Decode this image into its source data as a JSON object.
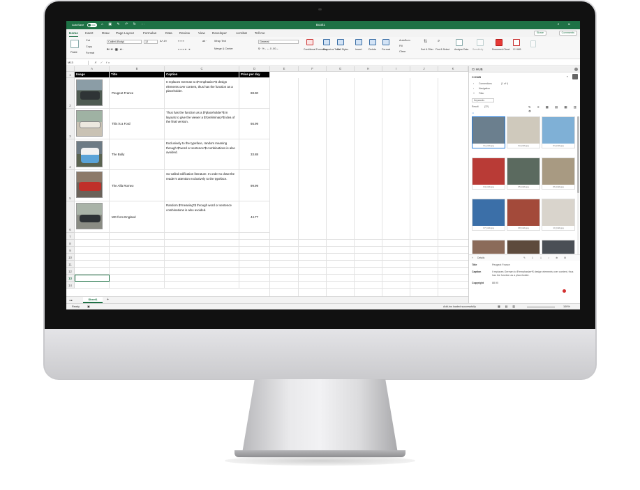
{
  "window": {
    "autosave_label": "AutoSave",
    "autosave_state": "OFF",
    "doc_title": "Book1"
  },
  "menu": {
    "tabs": [
      "Home",
      "Insert",
      "Draw",
      "Page Layout",
      "Formulas",
      "Data",
      "Review",
      "View",
      "Developer",
      "Acrobat",
      "Tell me"
    ],
    "share": "Share",
    "comments": "Comments"
  },
  "ribbon": {
    "paste": "Paste",
    "cut": "Cut",
    "copy": "Copy",
    "format": "Format",
    "font_name": "Calibri (Body)",
    "font_size": "12",
    "wrap_text": "Wrap Text",
    "merge_center": "Merge & Center",
    "number_format": "General",
    "conditional_formatting": "Conditional Formatting",
    "format_as_table": "Format as Table",
    "cell_styles": "Cell Styles",
    "insert": "Insert",
    "delete": "Delete",
    "format2": "Format",
    "autosum": "AutoSum",
    "fill": "Fill",
    "clear": "Clear",
    "sort_filter": "Sort & Filter",
    "find_select": "Find & Select",
    "analyze_data": "Analyze Data",
    "sensitivity": "Sensitivity",
    "document_cloud": "Document Cloud",
    "ci_hub": "CI HUB"
  },
  "formula_bar": {
    "name_box": "M13",
    "fx": "fx"
  },
  "sheet": {
    "columns": [
      "A",
      "B",
      "C",
      "D",
      "E",
      "F",
      "G",
      "H",
      "I",
      "J",
      "K"
    ],
    "header_row": {
      "image": "Image",
      "title": "Title",
      "caption": "Caption",
      "price": "Price per day"
    },
    "rows": [
      {
        "title": "Peugeot France",
        "caption": "It replaces German to $*emphasize*$ design elements over content, thus has the function as a placeholder.",
        "price": "88.90"
      },
      {
        "title": "This is a Ford",
        "caption": "Thus has the function as a $*placeholder*$ in layouts to give the viewer a $*preliminary*$ idea of the final version.",
        "price": "66.99"
      },
      {
        "title": "The Bully",
        "caption": "Exclusively to the typeface, random meaning through $*word or sentence*$ combinations is also avoided.",
        "price": "33.88"
      },
      {
        "title": "The Alfa Romeo",
        "caption": "So-called edification literature. In order to draw the reader's attention exclusively to the typeface.",
        "price": "99.99"
      },
      {
        "title": "MG from England",
        "caption": "Random $*meaning*$ through word or sentence combinations is also avoided.",
        "price": "44.77"
      }
    ],
    "row_numbers": [
      "1",
      "2",
      "3",
      "4",
      "5",
      "6",
      "7",
      "8",
      "9",
      "10",
      "11",
      "12",
      "13",
      "14"
    ],
    "sheet_tab": "Sheet1",
    "add_sheet": "+"
  },
  "status": {
    "ready": "Ready",
    "addins": "Add-ins loaded successfully",
    "zoom": "100%"
  },
  "panel": {
    "title": "CI HUB",
    "brand": "CI HUB",
    "connections": "Connections",
    "connections_count": "(1 of *)",
    "navigation": "Navigation",
    "filter": "Filter",
    "keywords": "Keywords",
    "result_label": "Result",
    "result_count": "(22)",
    "images": [
      {
        "name": "01_b&b.jpg",
        "color": "#6b7f8e"
      },
      {
        "name": "02_b&b.jpg",
        "color": "#cfc9bc"
      },
      {
        "name": "03_b&b.jpg",
        "color": "#7fb0d6"
      },
      {
        "name": "04_b&b.jpg",
        "color": "#b93b36"
      },
      {
        "name": "05_b&b.jpg",
        "color": "#5b6a5f"
      },
      {
        "name": "06_b&b.jpg",
        "color": "#a89a82"
      },
      {
        "name": "07_b&b.jpg",
        "color": "#3b6fa8"
      },
      {
        "name": "08_b&b.jpg",
        "color": "#a34a3a"
      },
      {
        "name": "10_b&b.jpg",
        "color": "#d9d4cc"
      }
    ],
    "details_label": "Details",
    "detail_title_label": "Title",
    "detail_title": "Peugeot France",
    "detail_caption_label": "Caption",
    "detail_caption": "It replaces German to $*emphasize*$ design elements over content, thus has the function as a placeholder.",
    "detail_copyright_label": "Copyright",
    "detail_copyright": "88.90"
  }
}
